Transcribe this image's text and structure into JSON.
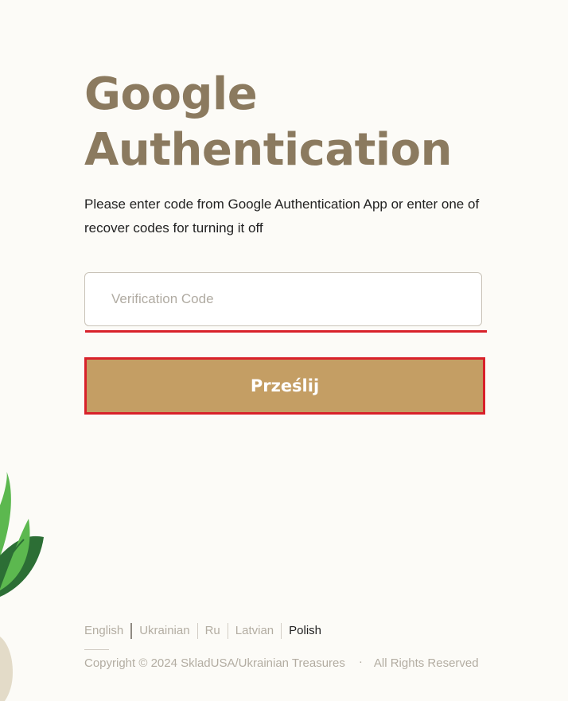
{
  "page": {
    "title": "Google Authentication",
    "description": "Please enter code from Google Authentication App or enter one of recover codes for turning it off"
  },
  "form": {
    "code_placeholder": "Verification Code",
    "code_value": "",
    "submit_label": "Prześlij"
  },
  "footer": {
    "languages": [
      "English",
      "Ukrainian",
      "Ru",
      "Latvian",
      "Polish"
    ],
    "active_language": "Polish",
    "copyright": "Copyright © 2024 SkladUSA/Ukrainian Treasures",
    "separator": "·",
    "rights": "All Rights Reserved"
  },
  "colors": {
    "background": "#fcfbf7",
    "title": "#8b7a5f",
    "button": "#c49e64",
    "error": "#d8212a",
    "leaf_light": "#5cb84f",
    "leaf_dark": "#2c6e35"
  }
}
